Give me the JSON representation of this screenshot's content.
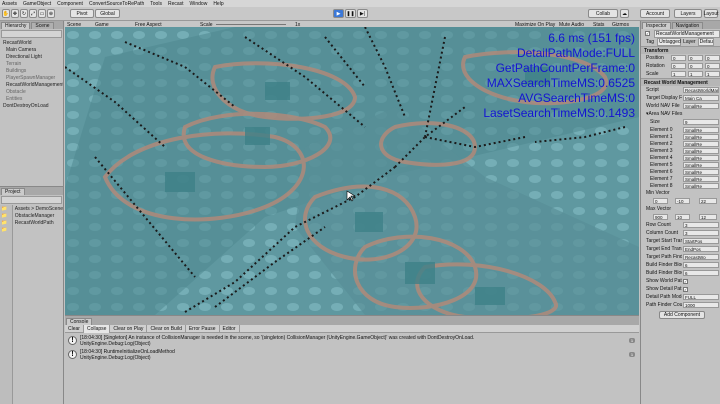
{
  "menu": [
    "Assets",
    "GameObject",
    "Component",
    "ConvertSourceToRePath",
    "Tools",
    "Recast",
    "Window",
    "Help"
  ],
  "toolbar": {
    "pivot_label": "Pivot",
    "global_label": "Global",
    "collab_label": "Collab",
    "account_label": "Account",
    "layers_label": "Layers",
    "layout_label": "Layout"
  },
  "hierarchy": {
    "tabs": [
      "Hierarchy",
      "Scene"
    ],
    "items": [
      {
        "label": "RecastWorld",
        "state": "normal"
      },
      {
        "label": "Main Camera",
        "state": "normal"
      },
      {
        "label": "Directional Light",
        "state": "normal"
      },
      {
        "label": "Terrain",
        "state": "dim"
      },
      {
        "label": "Buildings",
        "state": "dim"
      },
      {
        "label": "PlayerSpawnManager",
        "state": "dim"
      },
      {
        "label": "RecastWorldManagement",
        "state": "normal"
      },
      {
        "label": "Obstacle",
        "state": "dim"
      },
      {
        "label": "Entities",
        "state": "dim"
      },
      {
        "label": "DontDestroyOnLoad",
        "state": "normal"
      }
    ]
  },
  "project": {
    "tabs": [
      "Project"
    ],
    "breadcrumb": "Assets > DemoScene",
    "files": [
      "ObstacleManager",
      "RecastWorldPath"
    ]
  },
  "scene_view": {
    "tabs": [
      "Scene",
      "Game"
    ],
    "aspect": "Free Aspect",
    "scale_label": "Scale",
    "scale_value": "1x",
    "right_options": [
      "Maximize On Play",
      "Mute Audio",
      "Stats",
      "Gizmos"
    ]
  },
  "stats": {
    "line1": "6.6 ms (151 fps)",
    "line2": "DetailPathMode:FULL",
    "line3": "GetPathCountPerFrame:0",
    "line4": "MAXSearchTimeMS:0.6525",
    "line5": "AVGSearchTimeMS:0",
    "line6": "LasetSearchTimeMS:0.1493"
  },
  "console": {
    "tab": "Console",
    "toolbar": [
      "Clear",
      "Collapse",
      "Clear on Play",
      "Clear on Build",
      "Error Pause",
      "Editor"
    ],
    "logs": [
      {
        "line1": "[18:04:30] [Singleton] An instance of CollisionManager is needed in the scene, so '(singleton) CollisionManager (UnityEngine.GameObject)' was created with DontDestroyOnLoad.",
        "line2": "UnityEngine.Debug:Log(Object)",
        "count": "1"
      },
      {
        "line1": "[18:04:30] RuntimeInitializeOnLoadMethod",
        "line2": "UnityEngine.Debug:Log(Object)",
        "count": "1"
      }
    ]
  },
  "inspector": {
    "tabs": [
      "Inspector",
      "Navigation"
    ],
    "object_name": "RecastWorldManagement",
    "tag_label": "Tag",
    "tag_value": "Untagged",
    "layer_label": "Layer",
    "layer_value": "Default",
    "transform_title": "Transform",
    "position_label": "Position",
    "rotation_label": "Rotation",
    "scale_label": "Scale",
    "pos": [
      "0",
      "0",
      "0"
    ],
    "rot": [
      "0",
      "0",
      "0"
    ],
    "scl": [
      "1",
      "1",
      "1"
    ],
    "component_title": "Recast World Management",
    "fields": [
      {
        "label": "Script",
        "value": "RecastWorldManagem"
      },
      {
        "label": "Target Display FPS",
        "value": "Main Ca"
      },
      {
        "label": "World NAV File",
        "value": "SmallRe"
      }
    ],
    "area_nav_label": "Area NAV Files",
    "size_label": "Size",
    "size_value": "9",
    "elements": [
      {
        "label": "Element 0",
        "value": "SmallRe"
      },
      {
        "label": "Element 1",
        "value": "SmallRe"
      },
      {
        "label": "Element 2",
        "value": "SmallRe"
      },
      {
        "label": "Element 3",
        "value": "SmallRe"
      },
      {
        "label": "Element 4",
        "value": "SmallRe"
      },
      {
        "label": "Element 5",
        "value": "SmallRe"
      },
      {
        "label": "Element 6",
        "value": "SmallRe"
      },
      {
        "label": "Element 7",
        "value": "SmallRe"
      },
      {
        "label": "Element 8",
        "value": "SmallRe"
      }
    ],
    "min_vector_label": "Min Vector",
    "min_vector": [
      "0",
      "-10",
      "22"
    ],
    "max_vector_label": "Max Vector",
    "max_vector": [
      "900",
      "10",
      "12"
    ],
    "row_count_label": "Row Count",
    "row_count": "3",
    "col_count_label": "Column Count",
    "col_count": "3",
    "more_fields": [
      {
        "label": "Target Start Transform",
        "value": "StartPos"
      },
      {
        "label": "Target End Transform",
        "value": "EndPos"
      },
      {
        "label": "Target Path Finder Pr",
        "value": "RecastWo"
      },
      {
        "label": "Build Finder Block Ro",
        "value": "6"
      },
      {
        "label": "Build Finder Block Co",
        "value": "6"
      }
    ],
    "show_world_path_label": "Show World Path",
    "show_detail_path_label": "Show Detail Path",
    "detail_path_mode_label": "Detail Path Mode",
    "detail_path_mode_value": "FULL",
    "path_finder_count_label": "Path Finder Count",
    "path_finder_count_value": "1000",
    "add_component_label": "Add Component"
  }
}
